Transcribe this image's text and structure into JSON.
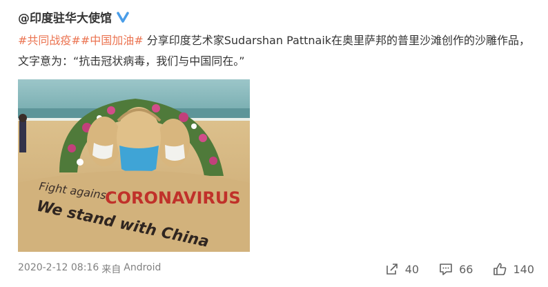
{
  "post": {
    "author": "@印度驻华大使馆",
    "hashtags": [
      "#共同战疫#",
      "#中国加油#"
    ],
    "body": " 分享印度艺术家Sudarshan Pattnaik在奥里萨邦的普里沙滩创作的沙雕作品，文字意为：“抗击冠状病毒，我们与中国同在。”",
    "image": {
      "sculpture_line1": "Fight against",
      "sculpture_word_red": "CORONAVIRUS",
      "sculpture_line2": "We stand with China"
    },
    "timestamp": "2020-2-12 08:16",
    "source_prefix": "来自",
    "source": "Android"
  },
  "actions": {
    "repost_count": "40",
    "comment_count": "66",
    "like_count": "140"
  },
  "icons": {
    "verified": "verified-badge-icon",
    "repost": "share-icon",
    "comment": "comment-icon",
    "like": "thumbs-up-icon"
  },
  "colors": {
    "hashtag": "#eb7350",
    "verified": "#4a9de8",
    "meta": "#808080"
  }
}
